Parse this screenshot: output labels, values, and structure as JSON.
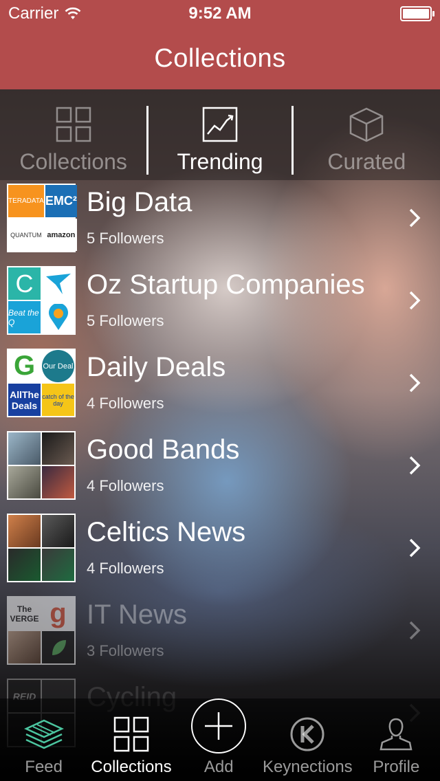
{
  "status_bar": {
    "carrier": "Carrier",
    "time": "9:52 AM"
  },
  "nav": {
    "title": "Collections"
  },
  "segments": [
    {
      "label": "Collections",
      "icon": "grid-icon"
    },
    {
      "label": "Trending",
      "icon": "trending-chart-icon"
    },
    {
      "label": "Curated",
      "icon": "box-icon"
    }
  ],
  "rows": [
    {
      "title": "Big Data",
      "followers": "5 Followers",
      "thumb_texts": [
        "TERADATA",
        "EMC²",
        "QUANTUM",
        "amazon"
      ],
      "thumb_colors": [
        "#f7931e",
        "#1b6fb5",
        "#ffffff",
        "#ffffff"
      ]
    },
    {
      "title": "Oz Startup Companies",
      "followers": "5 Followers",
      "thumb_texts": [
        "C",
        "",
        "Beat the Q",
        ""
      ],
      "thumb_colors": [
        "#2bb5a8",
        "#ffffff",
        "#1aa3d8",
        "#ffffff"
      ]
    },
    {
      "title": "Daily Deals",
      "followers": "4 Followers",
      "thumb_texts": [
        "G",
        "Our Deal",
        "AllThe Deals",
        "catch of the day"
      ],
      "thumb_colors": [
        "#ffffff",
        "#1d7a8c",
        "#1840a0",
        "#e03070"
      ]
    },
    {
      "title": "Good Bands",
      "followers": "4 Followers",
      "thumb_texts": [
        "",
        "",
        "",
        ""
      ],
      "thumb_colors": [
        "#6b8ea8",
        "#2a2a2a",
        "#8a8a7a",
        "#3a2a40"
      ]
    },
    {
      "title": "Celtics News",
      "followers": "4 Followers",
      "thumb_texts": [
        "",
        "",
        "",
        ""
      ],
      "thumb_colors": [
        "#b86a3a",
        "#3a3a3a",
        "#2a2a2a",
        "#1f6b40"
      ]
    },
    {
      "title": "IT News",
      "followers": "3 Followers",
      "thumb_texts": [
        "The VERGE",
        "g",
        "",
        ""
      ],
      "thumb_colors": [
        "#ffffff",
        "#ffffff",
        "#a0806a",
        "#1a1a1a"
      ]
    },
    {
      "title": "Cycling",
      "followers": "",
      "thumb_texts": [
        "REID",
        "",
        "",
        ""
      ],
      "thumb_colors": [
        "#1a1a1a",
        "#333333",
        "#222222",
        "#2a2a2a"
      ]
    }
  ],
  "tabbar": [
    {
      "label": "Feed",
      "icon": "layers-icon"
    },
    {
      "label": "Collections",
      "icon": "grid-icon"
    },
    {
      "label": "Add",
      "icon": "plus-circle-icon"
    },
    {
      "label": "Keynections",
      "icon": "k-logo-icon"
    },
    {
      "label": "Profile",
      "icon": "person-icon"
    }
  ],
  "colors": {
    "accent": "#b34c4c",
    "feed_icon": "#4cc6a0"
  }
}
